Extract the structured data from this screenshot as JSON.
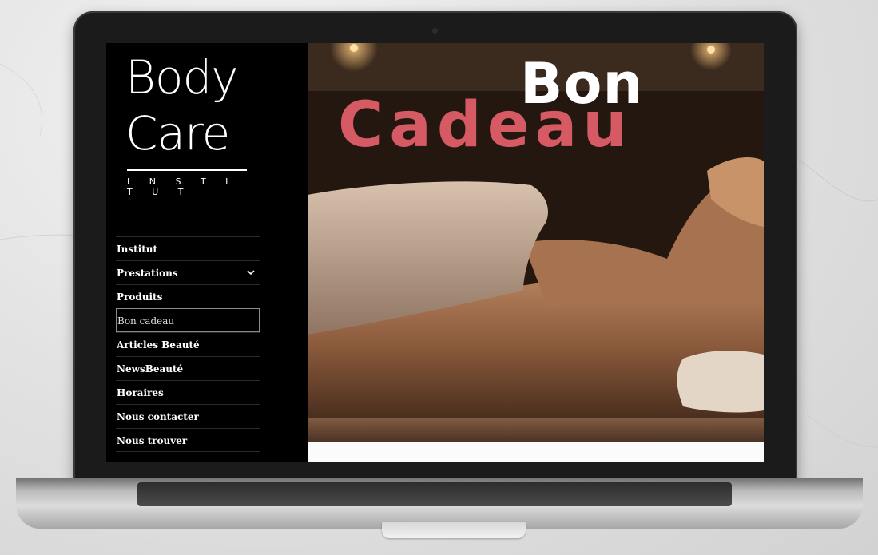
{
  "logo": {
    "line1": "Body",
    "line2": "Care",
    "subtitle": "I N S T I T U T"
  },
  "nav": {
    "items": [
      {
        "label": "Institut",
        "has_submenu": false,
        "active": false
      },
      {
        "label": "Prestations",
        "has_submenu": true,
        "active": false
      },
      {
        "label": "Produits",
        "has_submenu": false,
        "active": false
      },
      {
        "label": "Bon cadeau",
        "has_submenu": false,
        "active": true
      },
      {
        "label": "Articles Beauté",
        "has_submenu": false,
        "active": false
      },
      {
        "label": "NewsBeauté",
        "has_submenu": false,
        "active": false
      },
      {
        "label": "Horaires",
        "has_submenu": false,
        "active": false
      },
      {
        "label": "Nous contacter",
        "has_submenu": false,
        "active": false
      },
      {
        "label": "Nous trouver",
        "has_submenu": false,
        "active": false
      }
    ],
    "chevron_icon": "chevron-down-icon"
  },
  "hero": {
    "title_line1": "Bon",
    "title_line2": "Cadeau",
    "title_line1_color": "#ffffff",
    "title_line2_color": "#d55a63"
  },
  "colors": {
    "sidebar_bg": "#000000",
    "accent": "#d55a63"
  }
}
